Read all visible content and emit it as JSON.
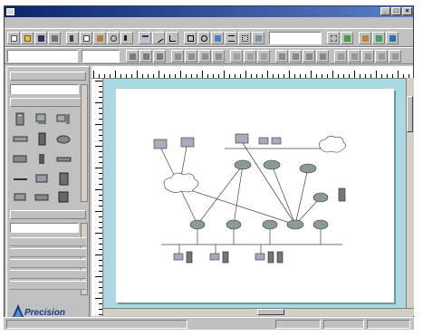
{
  "window": {
    "title": ""
  },
  "menu": {
    "items": [
      "",
      "",
      "",
      "",
      "",
      "",
      "",
      "",
      ""
    ]
  },
  "palette": {
    "headers": [
      "",
      "",
      ""
    ],
    "fields": [
      "",
      ""
    ],
    "logo": {
      "name": "Precision",
      "tagline": ""
    }
  },
  "diagram": {
    "title": "",
    "caption_lines": [
      "",
      "",
      ""
    ]
  },
  "status": {
    "cells": [
      "",
      "",
      "",
      ""
    ]
  },
  "colors": {
    "titlebar": "#0a246a",
    "canvas": "#a8d8e0",
    "paper": "#ffffff",
    "chrome": "#c0c0c0"
  },
  "icons": [
    "app-icon",
    "new-icon",
    "open-icon",
    "save-icon",
    "print-icon",
    "cut-icon",
    "copy-icon",
    "paste-icon",
    "zoom-icon",
    "pointer-icon",
    "text-icon",
    "line-icon",
    "connector-icon",
    "rectangle-icon",
    "ellipse-icon",
    "font-icon",
    "align-icon",
    "group-icon",
    "layer-icon",
    "grid-icon",
    "snap-icon"
  ]
}
